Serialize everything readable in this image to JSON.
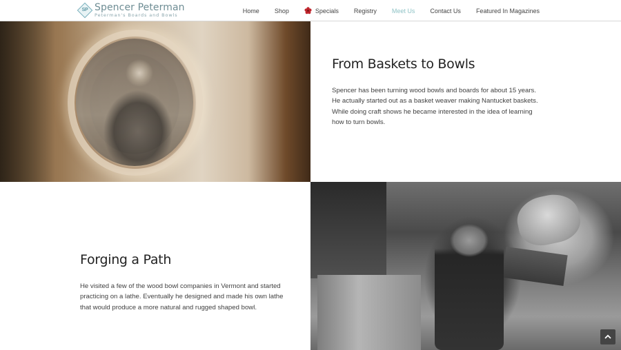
{
  "brand": {
    "initials": "SP",
    "name": "Spencer Peterman",
    "tagline": "Peterman's Boards and Bowls"
  },
  "nav": {
    "items": [
      {
        "label": "Home"
      },
      {
        "label": "Shop"
      },
      {
        "label": "Specials",
        "icon": "flower-icon"
      },
      {
        "label": "Registry"
      },
      {
        "label": "Meet Us",
        "active": true
      },
      {
        "label": "Contact Us"
      },
      {
        "label": "Featured In Magazines"
      }
    ]
  },
  "sections": [
    {
      "heading": "From Baskets to Bowls",
      "body": "Spencer has been turning wood bowls and boards for about 15 years. He actually started out as a basket weaver making Nantucket baskets. While doing craft shows he became interested in the idea of learning how to turn bowls."
    },
    {
      "heading": "Forging a Path",
      "body": "He visited a few of the wood bowl companies in Vermont and started practicing on a lathe. Eventually he designed and made his own lathe that would produce a more natural and rugged shaped bowl."
    }
  ],
  "colors": {
    "active_nav": "#8fc3c6",
    "specials_icon": "#c0262d",
    "brand": "#6e8d94"
  },
  "scroll_top": {
    "icon": "arrow-up-icon"
  }
}
